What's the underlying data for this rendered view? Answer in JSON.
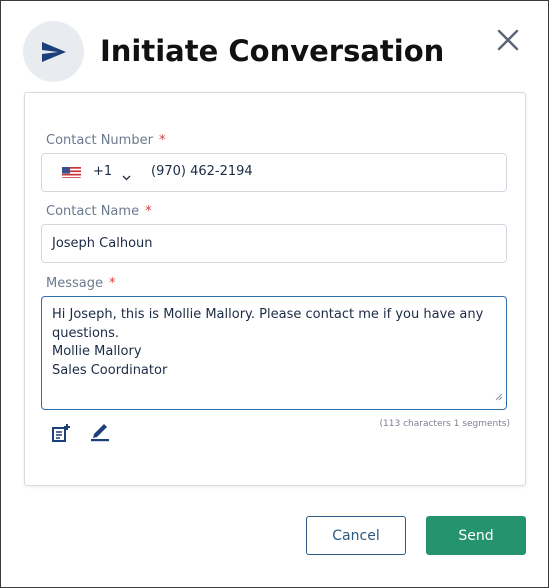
{
  "dialog": {
    "title": "Initiate Conversation",
    "header_icon": "send-icon",
    "close_icon": "close-icon"
  },
  "form": {
    "contact_number": {
      "label": "Contact Number",
      "required_mark": "*",
      "country_flag": "us-flag-icon",
      "dial_code": "+1",
      "dropdown_icon": "chevron-down-icon",
      "value": "(970) 462-2194"
    },
    "contact_name": {
      "label": "Contact Name",
      "required_mark": "*",
      "value": "Joseph Calhoun"
    },
    "message": {
      "label": "Message",
      "required_mark": "*",
      "value": "Hi Joseph, this is Mollie Mallory. Please contact me if you have any questions.\nMollie Mallory\nSales Coordinator",
      "counter": "(113 characters 1 segments)"
    },
    "tools": {
      "template_icon": "template-add-icon",
      "signature_icon": "signature-pen-icon"
    }
  },
  "footer": {
    "cancel_label": "Cancel",
    "send_label": "Send"
  },
  "colors": {
    "accent_send": "#25936d",
    "accent_cancel": "#2d5a80",
    "focus_border": "#2f6fb1",
    "required": "#d63b3b",
    "icon_blue": "#1d3f7a"
  }
}
